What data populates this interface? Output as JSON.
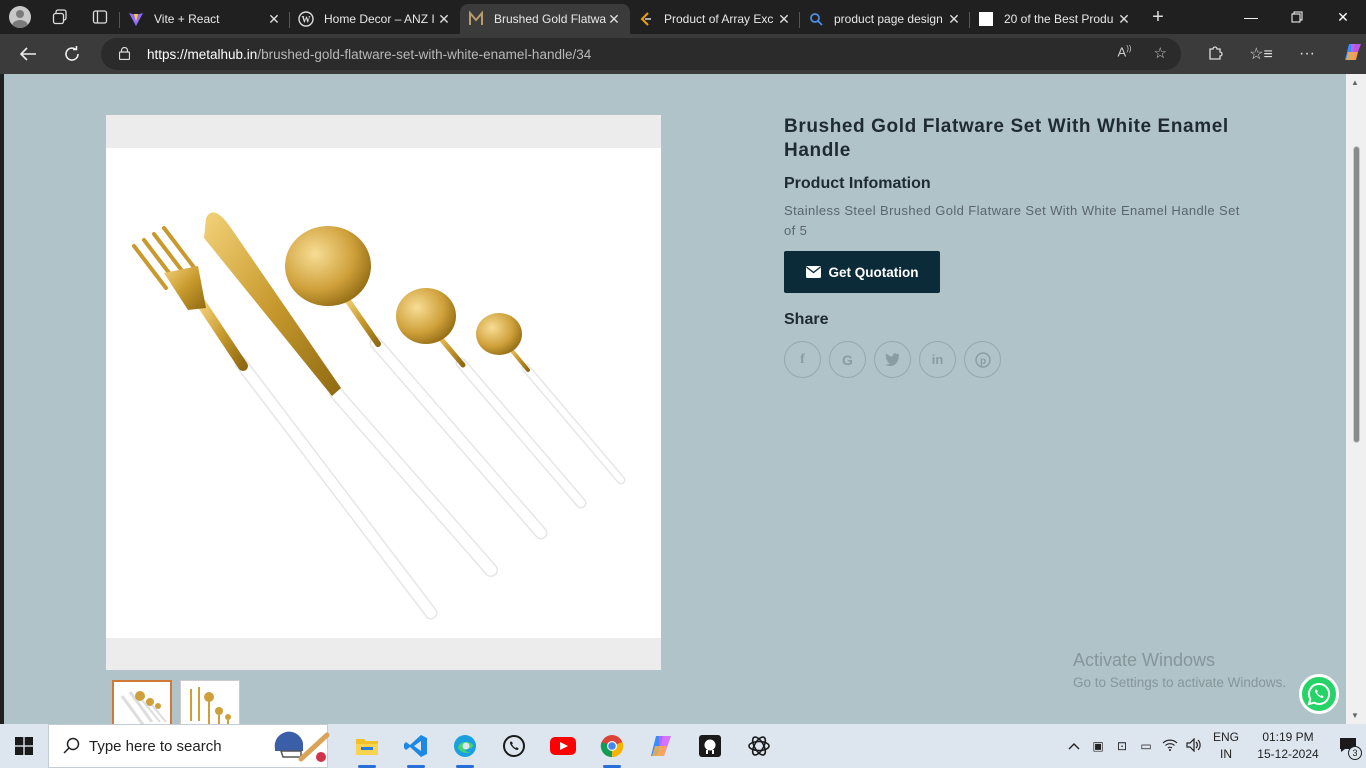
{
  "browser": {
    "tabs": [
      {
        "title": "Vite + React",
        "icon": "vite-icon",
        "active": false
      },
      {
        "title": "Home Decor – ANZ I",
        "icon": "wordpress-icon",
        "active": false
      },
      {
        "title": "Brushed Gold Flatwa",
        "icon": "metalhub-icon",
        "active": true
      },
      {
        "title": "Product of Array Exc",
        "icon": "leetcode-icon",
        "active": false
      },
      {
        "title": "product page design",
        "icon": "search-icon",
        "active": false
      },
      {
        "title": "20 of the Best Produ",
        "icon": "page-icon",
        "active": false
      }
    ],
    "url_host": "https://metalhub.in",
    "url_path": "/brushed-gold-flatware-set-with-white-enamel-handle/34"
  },
  "product": {
    "title": "Brushed Gold Flatware Set With White Enamel Handle",
    "info_heading": "Product Infomation",
    "description": "Stainless Steel Brushed Gold Flatware Set With White Enamel Handle Set of 5",
    "quote_button": "Get Quotation",
    "share_heading": "Share",
    "share_icons": [
      "facebook-icon",
      "google-icon",
      "twitter-icon",
      "linkedin-icon",
      "pinterest-icon"
    ]
  },
  "watermark": {
    "line1": "Activate Windows",
    "line2": "Go to Settings to activate Windows."
  },
  "taskbar": {
    "search_placeholder": "Type here to search",
    "lang_line1": "ENG",
    "lang_line2": "IN",
    "time": "01:19 PM",
    "date": "15-12-2024",
    "notifications": "3"
  },
  "colors": {
    "page_bg": "#b0c3c8",
    "button_bg": "#0b2b38",
    "title_text": "#1f2a33"
  }
}
